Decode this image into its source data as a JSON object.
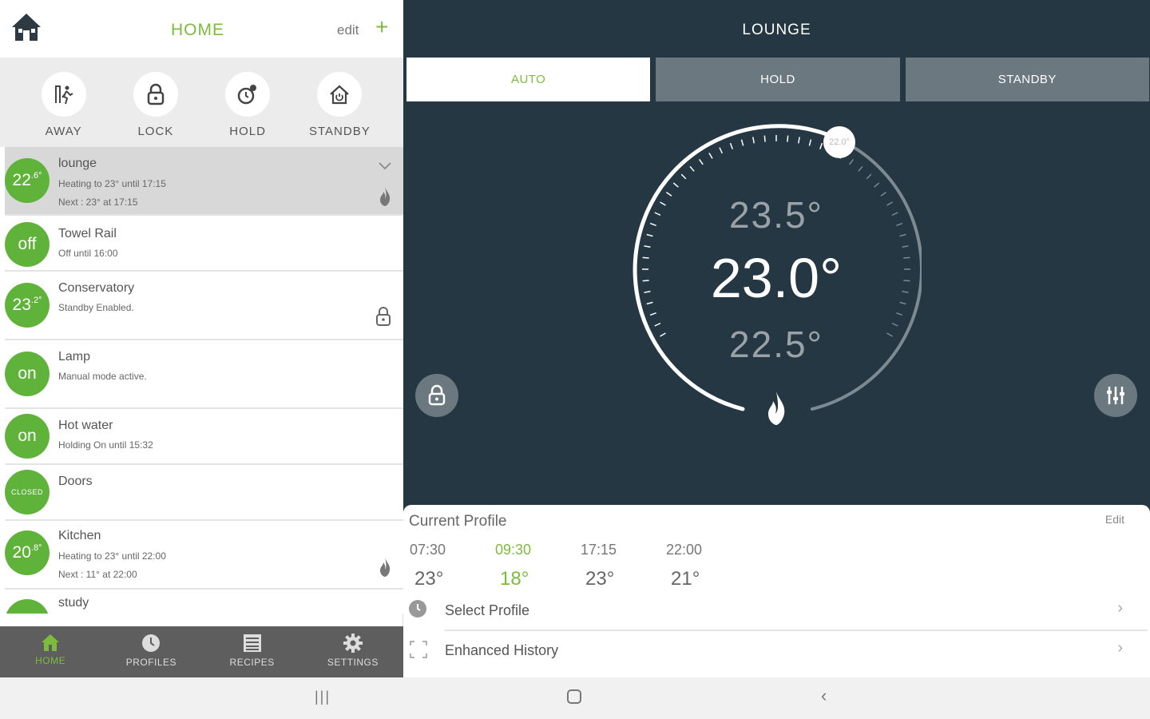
{
  "header": {
    "title": "HOME",
    "edit_label": "edit",
    "add_label": "+"
  },
  "modes": [
    {
      "label": "AWAY",
      "icon": "away-icon"
    },
    {
      "label": "LOCK",
      "icon": "lock-icon"
    },
    {
      "label": "HOLD",
      "icon": "hold-icon"
    },
    {
      "label": "STANDBY",
      "icon": "standby-icon"
    }
  ],
  "zones": [
    {
      "name": "lounge",
      "badge": "22",
      "badge_sup": ".6°",
      "line1": "Heating to 23° until 17:15",
      "line2": "Next : 23° at 17:15",
      "selected": true,
      "right_icon": "flame-icon"
    },
    {
      "name": "Towel Rail",
      "badge": "off",
      "badge_sup": "",
      "line1": "Off until 16:00",
      "line2": ""
    },
    {
      "name": "Conservatory",
      "badge": "23",
      "badge_sup": ".2°",
      "line1": "Standby Enabled.",
      "line2": "",
      "right_icon": "lock-icon"
    },
    {
      "name": "Lamp",
      "badge": "on",
      "badge_sup": "",
      "line1": "Manual mode active.",
      "line2": ""
    },
    {
      "name": "Hot water",
      "badge": "on",
      "badge_sup": "",
      "line1": "Holding On until 15:32",
      "line2": ""
    },
    {
      "name": "Doors",
      "badge": "CLOSED",
      "badge_sup": "",
      "line1": "",
      "line2": ""
    },
    {
      "name": "Kitchen",
      "badge": "20",
      "badge_sup": ".8°",
      "line1": "Heating to 23° until 22:00",
      "line2": "Next : 11° at 22:00",
      "right_icon": "flame-icon"
    },
    {
      "name": "study",
      "badge": "",
      "badge_sup": "",
      "line1": "",
      "line2": ""
    }
  ],
  "bottom_nav": [
    {
      "label": "HOME",
      "active": true
    },
    {
      "label": "PROFILES"
    },
    {
      "label": "RECIPES"
    },
    {
      "label": "SETTINGS"
    }
  ],
  "room": {
    "title": "LOUNGE",
    "tabs": [
      {
        "label": "AUTO",
        "active": true
      },
      {
        "label": "HOLD"
      },
      {
        "label": "STANDBY"
      }
    ],
    "temp_upper": "23.5°",
    "temp_main": "23.0°",
    "temp_lower": "22.5°",
    "setpoint_knob": "22.0°"
  },
  "profile": {
    "title": "Current Profile",
    "edit_label": "Edit",
    "slots": [
      {
        "time": "07:30",
        "temp": "23°"
      },
      {
        "time": "09:30",
        "temp": "18°",
        "active": true
      },
      {
        "time": "17:15",
        "temp": "23°"
      },
      {
        "time": "22:00",
        "temp": "21°"
      }
    ],
    "menu": [
      {
        "label": "Select Profile"
      },
      {
        "label": "Enhanced History"
      }
    ]
  },
  "colors": {
    "accent": "#7dbb3c",
    "badge": "#5fb33a",
    "panel": "#243743",
    "tab": "#6b7880"
  }
}
